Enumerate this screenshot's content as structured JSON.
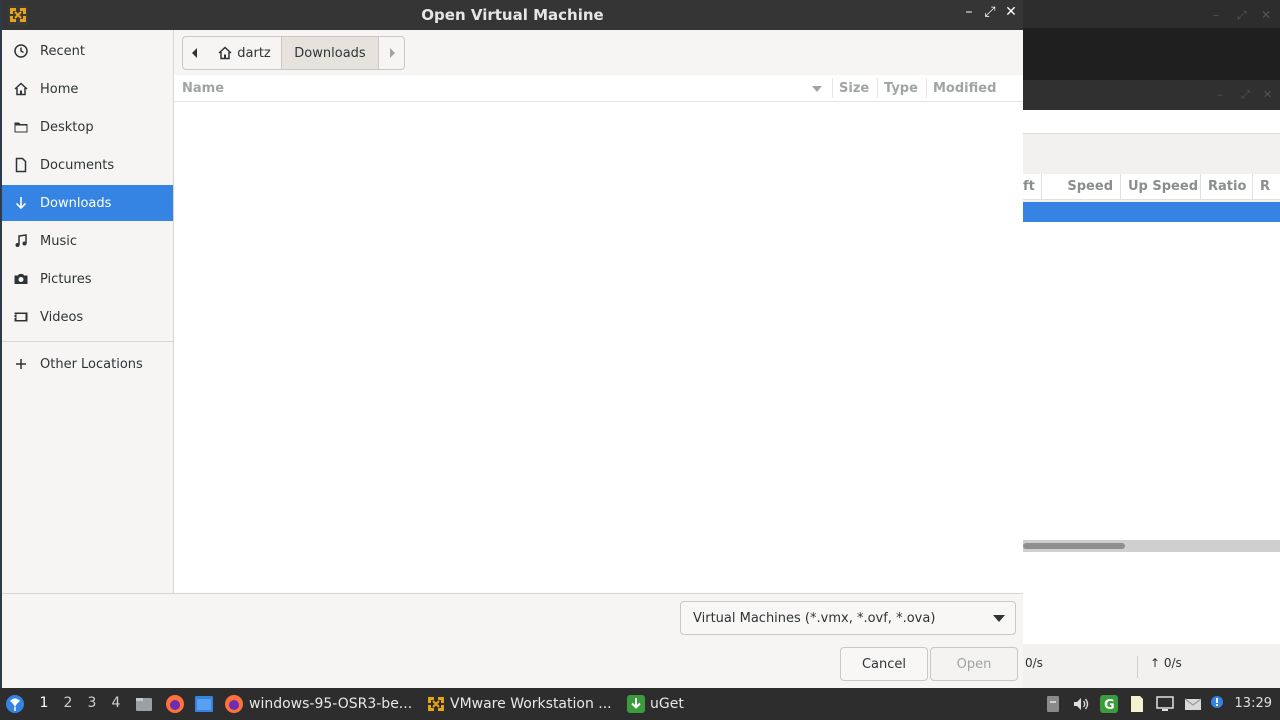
{
  "dialog": {
    "title": "Open Virtual Machine",
    "window_controls": {
      "minimize": "–",
      "maximize": "⤢",
      "close": "✕"
    }
  },
  "sidebar": {
    "items": [
      {
        "label": "Recent",
        "icon": "clock-icon"
      },
      {
        "label": "Home",
        "icon": "home-icon"
      },
      {
        "label": "Desktop",
        "icon": "folder-icon"
      },
      {
        "label": "Documents",
        "icon": "document-icon"
      },
      {
        "label": "Downloads",
        "icon": "download-icon",
        "active": true
      },
      {
        "label": "Music",
        "icon": "music-icon"
      },
      {
        "label": "Pictures",
        "icon": "camera-icon"
      },
      {
        "label": "Videos",
        "icon": "video-icon"
      },
      {
        "label": "Other Locations",
        "icon": "plus-icon"
      }
    ]
  },
  "pathbar": {
    "crumbs": [
      "dartz",
      "Downloads"
    ]
  },
  "file_list": {
    "columns": [
      "Name",
      "Size",
      "Type",
      "Modified"
    ],
    "rows": []
  },
  "footer": {
    "filter_value": "Virtual Machines (*.vmx, *.ovf, *.ova)",
    "cancel_label": "Cancel",
    "open_label": "Open"
  },
  "background_window": {
    "columns": [
      "ft",
      "Speed",
      "Up Speed",
      "Ratio",
      "R"
    ],
    "status_down": "0/s",
    "status_up": "↑ 0/s"
  },
  "taskbar": {
    "workspaces": [
      "1",
      "2",
      "3",
      "4"
    ],
    "tasks": [
      {
        "label": "windows-95-OSR3-be..."
      },
      {
        "label": "VMware Workstation ..."
      },
      {
        "label": "uGet"
      }
    ],
    "clock": "13:29"
  },
  "colors": {
    "accent": "#3584e4",
    "titlebar": "#353535",
    "taskbar": "#2d2d2d"
  }
}
